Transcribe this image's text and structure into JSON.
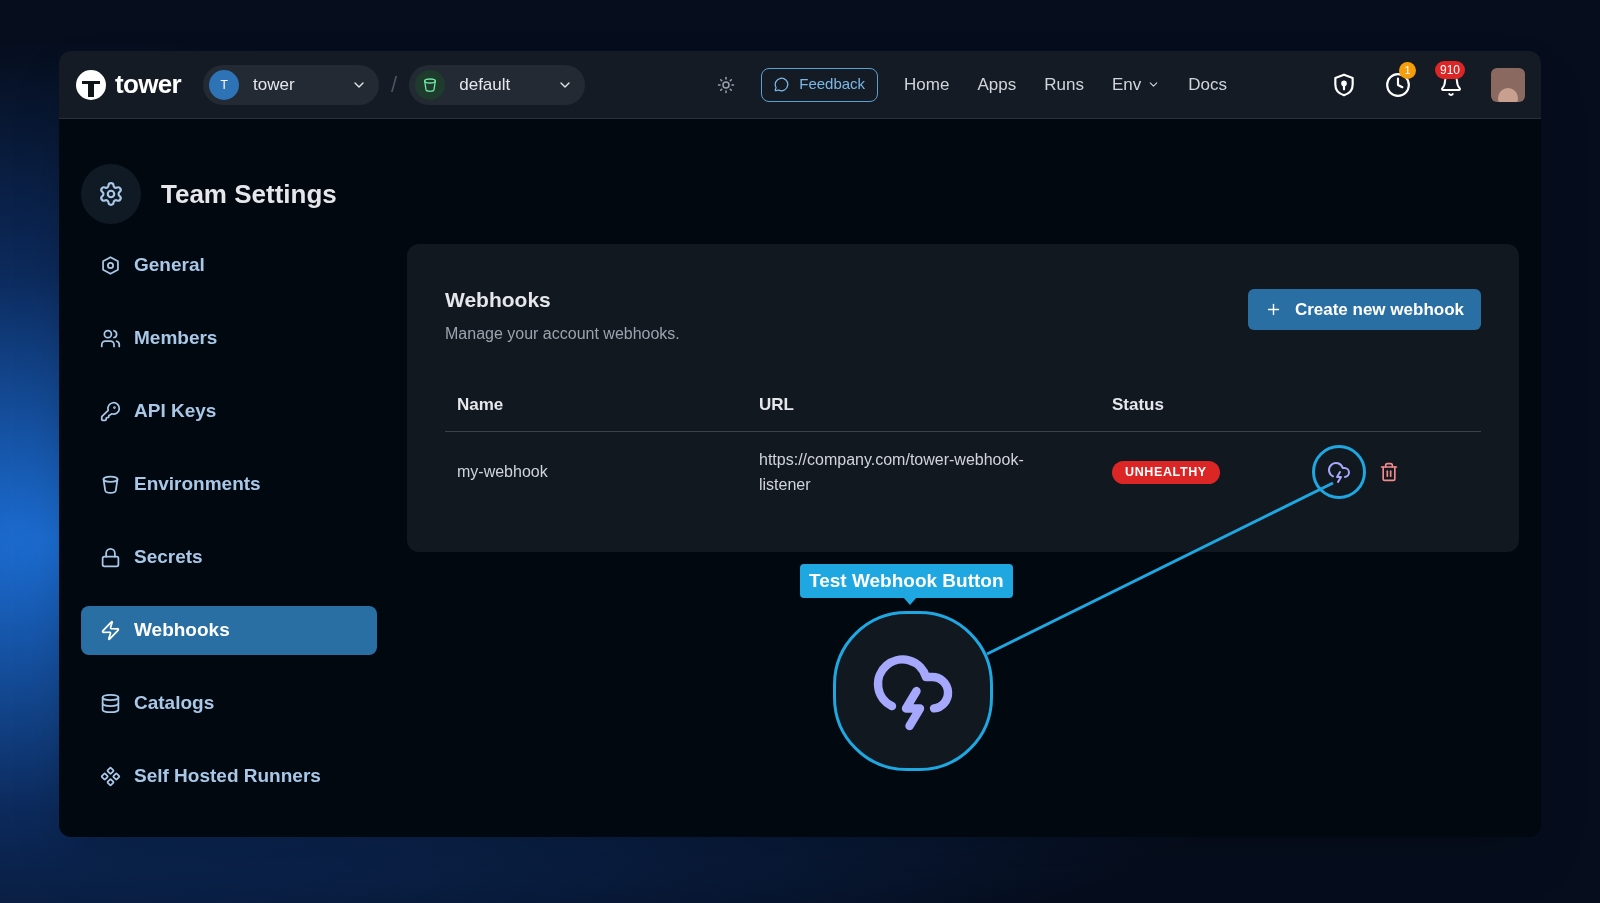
{
  "header": {
    "logo_text": "tower",
    "workspace": {
      "initial": "T",
      "name": "tower"
    },
    "separator": "/",
    "environment": {
      "name": "default"
    },
    "feedback": "Feedback",
    "nav": [
      {
        "label": "Home",
        "kind": "link"
      },
      {
        "label": "Apps",
        "kind": "link"
      },
      {
        "label": "Runs",
        "kind": "link"
      },
      {
        "label": "Env",
        "kind": "dropdown"
      },
      {
        "label": "Docs",
        "kind": "link"
      }
    ],
    "clock_badge": "1",
    "bell_badge": "910"
  },
  "sidebar": {
    "title": "Team Settings",
    "items": [
      {
        "label": "General",
        "selected": false
      },
      {
        "label": "Members",
        "selected": false
      },
      {
        "label": "API Keys",
        "selected": false
      },
      {
        "label": "Environments",
        "selected": false
      },
      {
        "label": "Secrets",
        "selected": false
      },
      {
        "label": "Webhooks",
        "selected": true
      },
      {
        "label": "Catalogs",
        "selected": false
      },
      {
        "label": "Self Hosted Runners",
        "selected": false
      }
    ]
  },
  "card": {
    "title": "Webhooks",
    "subtitle": "Manage your account webhooks.",
    "create_button": "Create new webhook",
    "table": {
      "columns": [
        "Name",
        "URL",
        "Status"
      ],
      "rows": [
        {
          "name": "my-webhook",
          "url": "https://company.com/tower-webhook-listener",
          "status": "UNHEALTHY"
        }
      ]
    }
  },
  "annotation": {
    "label": "Test Webhook Button"
  }
}
